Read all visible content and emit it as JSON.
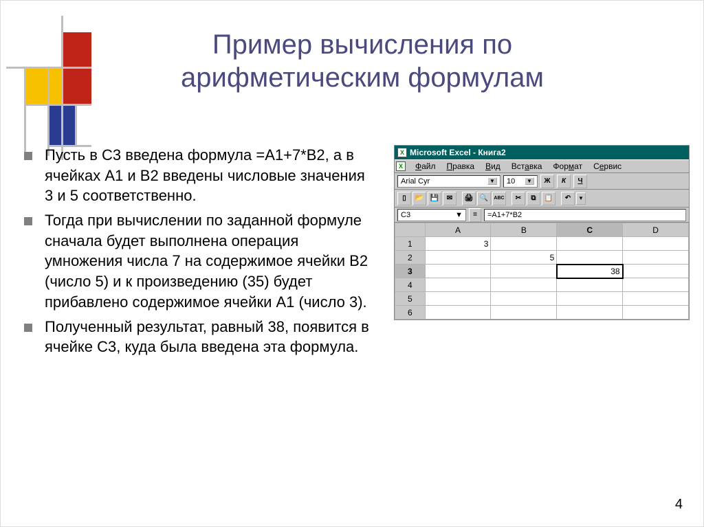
{
  "title_line1": "Пример вычисления по",
  "title_line2": "арифметическим формулам",
  "bullets": [
    "Пусть в C3 введена формула =A1+7*B2, а в ячейках A1 и B2 введены числовые значения 3 и 5 соответственно.",
    "Тогда при вычислении по заданной формуле сначала будет выполнена операция умножения числа 7 на содержимое ячейки B2 (число 5) и к произведению (35) будет прибавлено содержимое ячейки A1 (число 3).",
    "Полученный результат, равный 38, появится в ячейке C3, куда была введена эта формула."
  ],
  "excel": {
    "title": "Microsoft Excel - Книга2",
    "menu": [
      "Файл",
      "Правка",
      "Вид",
      "Вставка",
      "Формат",
      "Сервис"
    ],
    "font_name": "Arial Cyr",
    "font_size": "10",
    "style_buttons": [
      "Ж",
      "К",
      "Ч"
    ],
    "toolbar_icons": [
      "new-icon",
      "open-icon",
      "save-icon",
      "email-icon",
      "print-icon",
      "preview-icon",
      "sep",
      "cut-icon",
      "copy-icon",
      "paste-icon",
      "sep",
      "undo-icon"
    ],
    "namebox": "C3",
    "formula": "=A1+7*B2",
    "columns": [
      "A",
      "B",
      "C",
      "D"
    ],
    "rows": [
      "1",
      "2",
      "3",
      "4",
      "5",
      "6"
    ],
    "cells": {
      "A1": "3",
      "B2": "5",
      "C3": "38"
    },
    "active_col": "C",
    "active_row": "3"
  },
  "page_number": "4"
}
